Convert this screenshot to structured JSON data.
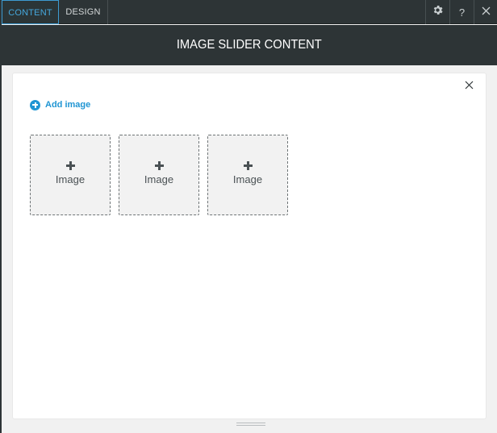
{
  "tabs": {
    "content": "CONTENT",
    "design": "DESIGN"
  },
  "toolbar": {
    "settings_icon": "gear-icon",
    "help_label": "?",
    "close_icon": "close-icon"
  },
  "header": {
    "title": "IMAGE SLIDER CONTENT"
  },
  "panel": {
    "add_image_label": "Add image",
    "slots": [
      {
        "label": "Image"
      },
      {
        "label": "Image"
      },
      {
        "label": "Image"
      }
    ]
  },
  "colors": {
    "header_bg": "#2d3436",
    "accent": "#1f95d3",
    "active_tab": "#45a8dd",
    "slot_bg": "#f2f2f2"
  }
}
